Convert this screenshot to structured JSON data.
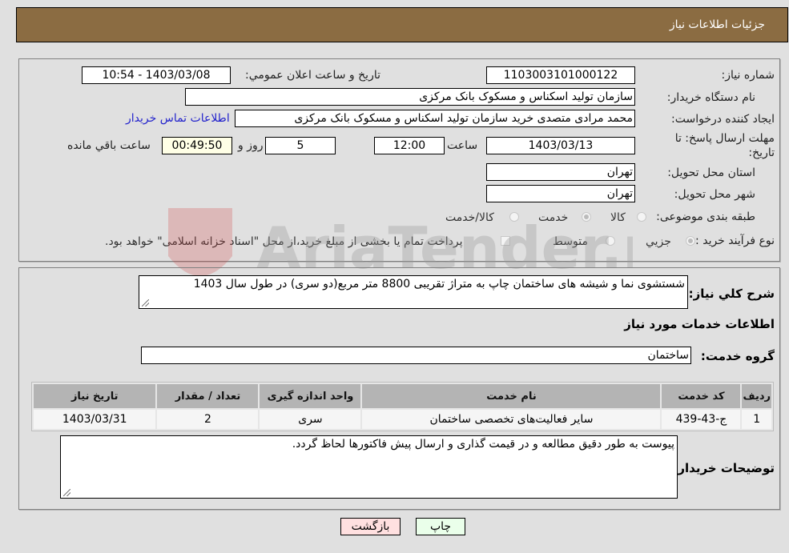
{
  "header": {
    "title": "جزئیات اطلاعات نیاز"
  },
  "details": {
    "need_number": {
      "label": "شماره نیاز:",
      "value": "1103003101000122"
    },
    "announce": {
      "label": "تاریخ و ساعت اعلان عمومي:",
      "value": "1403/03/08 - 10:54"
    },
    "buyer_org": {
      "label": "نام دستگاه خریدار:",
      "value": "سازمان تولید اسکناس و مسکوک بانک مرکزی"
    },
    "creator": {
      "label": "ایجاد کننده درخواست:",
      "value": "محمد مرادی متصدی خرید سازمان تولید اسکناس و مسکوک بانک مرکزی",
      "contact_link": "اطلاعات تماس خریدار"
    },
    "deadline": {
      "label_line1": "مهلت ارسال پاسخ: تا",
      "label_line2": "تاریخ:",
      "date": "1403/03/13",
      "time_label": "ساعت",
      "time": "12:00",
      "days": "5",
      "days_label": "روز و",
      "remaining": "00:49:50",
      "remaining_label": "ساعت باقي مانده"
    },
    "province": {
      "label": "استان محل تحویل:",
      "value": "تهران"
    },
    "city": {
      "label": "شهر محل تحویل:",
      "value": "تهران"
    },
    "category": {
      "label": "طبقه بندی موضوعی:",
      "options": [
        {
          "label": "کالا",
          "selected": false
        },
        {
          "label": "خدمت",
          "selected": true
        },
        {
          "label": "کالا/خدمت",
          "selected": false
        }
      ]
    },
    "process": {
      "label": "نوع فرآیند خرید :",
      "options": [
        {
          "label": "جزيي",
          "selected": true
        },
        {
          "label": "متوسط",
          "selected": false
        }
      ],
      "treasury_note": "پرداخت تمام يا بخشی از مبلغ خرید،از محل \"اسناد خزانه اسلامی\" خواهد بود."
    }
  },
  "summary": {
    "label": "شرح کلي نياز:",
    "value": "شستشوی نما و شیشه های ساختمان چاپ به متراژ تقریبی 8800 متر مربع(دو سری) در طول سال 1403"
  },
  "services": {
    "section_title": "اطلاعات خدمات مورد نياز",
    "group_label": "گروه خدمت:",
    "group_value": "ساختمان",
    "columns": [
      "رديف",
      "کد خدمت",
      "نام خدمت",
      "واحد اندازه گیری",
      "تعداد / مقدار",
      "تاريخ نياز"
    ],
    "rows": [
      [
        "1",
        "ج-43-439",
        "سایر فعالیت‌های تخصصی ساختمان",
        "سری",
        "2",
        "1403/03/31"
      ]
    ]
  },
  "buyer_notes": {
    "label": "توضيحات خريدار:",
    "value": "پیوست به طور دقیق مطالعه و در قیمت گذاری و ارسال پیش فاکتورها لحاظ گردد."
  },
  "buttons": {
    "print": "چاپ",
    "back": "بازگشت"
  },
  "watermark": {
    "text": "AriaTender.neT"
  }
}
